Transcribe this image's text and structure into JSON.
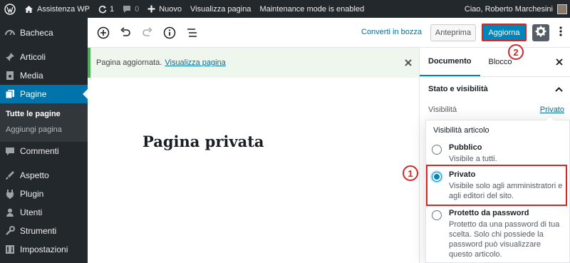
{
  "admin_bar": {
    "site_name": "Assistenza WP",
    "updates_count": "1",
    "comments_count": "0",
    "new_label": "Nuovo",
    "view_page": "Visualizza pagina",
    "maintenance": "Maintenance mode is enabled",
    "greeting": "Ciao, Roberto Marchesini"
  },
  "sidebar": {
    "items": [
      {
        "label": "Bacheca",
        "icon": "dashboard-icon"
      },
      {
        "label": "Articoli",
        "icon": "pin-icon"
      },
      {
        "label": "Media",
        "icon": "media-icon"
      },
      {
        "label": "Pagine",
        "icon": "pages-icon"
      },
      {
        "label": "Commenti",
        "icon": "comments-icon"
      },
      {
        "label": "Aspetto",
        "icon": "appearance-icon"
      },
      {
        "label": "Plugin",
        "icon": "plugin-icon"
      },
      {
        "label": "Utenti",
        "icon": "users-icon"
      },
      {
        "label": "Strumenti",
        "icon": "tools-icon"
      },
      {
        "label": "Impostazioni",
        "icon": "settings-icon"
      }
    ],
    "submenu": [
      "Tutte le pagine",
      "Aggiungi pagina"
    ]
  },
  "toolbar": {
    "draft_label": "Converti in bozza",
    "preview_label": "Anteprima",
    "update_label": "Aggiorna"
  },
  "notice": {
    "text": "Pagina aggiornata.",
    "link": "Visualizza pagina"
  },
  "editor": {
    "title": "Pagina privata"
  },
  "panel": {
    "tab_document": "Documento",
    "tab_block": "Blocco",
    "section_title": "Stato e visibilità",
    "visibility_label": "Visibilità",
    "visibility_value": "Privato"
  },
  "popover": {
    "title": "Visibilità articolo",
    "options": [
      {
        "label": "Pubblico",
        "desc": "Visibile a tutti.",
        "checked": false
      },
      {
        "label": "Privato",
        "desc": "Visibile solo agli amministratori e agli editori del sito.",
        "checked": true
      },
      {
        "label": "Protetto da password",
        "desc": "Protetto da una password di tua scelta. Solo chi possiede la password può visualizzare questo articolo.",
        "checked": false
      }
    ]
  },
  "annotations": {
    "step1": "1",
    "step2": "2"
  },
  "colors": {
    "admin_dark": "#23282d",
    "wp_blue": "#0073aa",
    "button_blue": "#0085ba",
    "highlight_red": "#d32828",
    "notice_green": "#46b450"
  }
}
